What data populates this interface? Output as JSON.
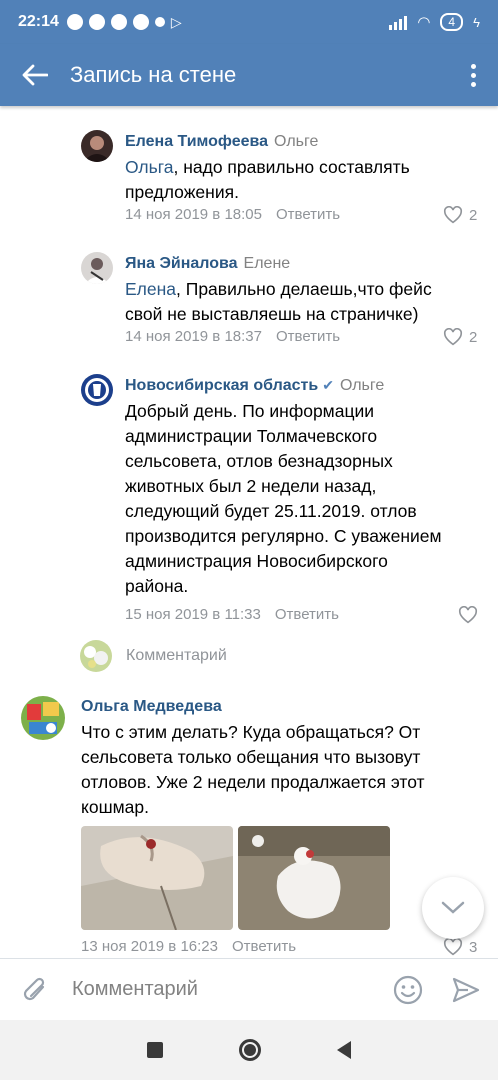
{
  "status_bar": {
    "time": "22:14",
    "battery": "4"
  },
  "app_bar": {
    "title": "Запись на стене"
  },
  "comments": [
    {
      "author": "Елена Тимофеева",
      "reply_to": "Ольге",
      "mention": "Ольга",
      "text_line1": ", надо правильно составлять",
      "text_line2": "предложения.",
      "date": "14 ноя 2019 в 18:05",
      "reply_label": "Ответить",
      "likes": "2"
    },
    {
      "author": "Яна Эйналова",
      "reply_to": "Елене",
      "mention": "Елена",
      "text_line1": ", Правильно делаешь,что фейс",
      "text_line2": "свой не выставляешь на страничке)",
      "date": "14 ноя 2019 в 18:37",
      "reply_label": "Ответить",
      "likes": "2"
    },
    {
      "author": "Новосибирская область",
      "reply_to": "Ольге",
      "lines": [
        "Добрый день. По информации",
        "администрации Толмачевского",
        "сельсовета, отлов безнадзорных",
        "животных был 2 недели назад,",
        "следующий будет 25.11.2019. отлов",
        "производится регулярно. С уважением",
        "администрация Новосибирского",
        "района."
      ],
      "date": "15 ноя 2019 в 11:33",
      "reply_label": "Ответить",
      "likes": ""
    }
  ],
  "add_comment": {
    "placeholder": "Комментарий"
  },
  "root_comment": {
    "author": "Ольга Медведева",
    "lines": [
      "Что с этим делать? Куда обращаться? От",
      "сельсовета только обещания что вызовут",
      "отловов. Уже 2 недели продалжается этот",
      "кошмар."
    ],
    "date": "13 ноя 2019 в 16:23",
    "reply_label": "Ответить",
    "likes": "3"
  },
  "composer": {
    "placeholder": "Комментарий"
  },
  "colors": {
    "brand": "#5181b8",
    "link": "#2a5885",
    "meta": "#909499"
  }
}
